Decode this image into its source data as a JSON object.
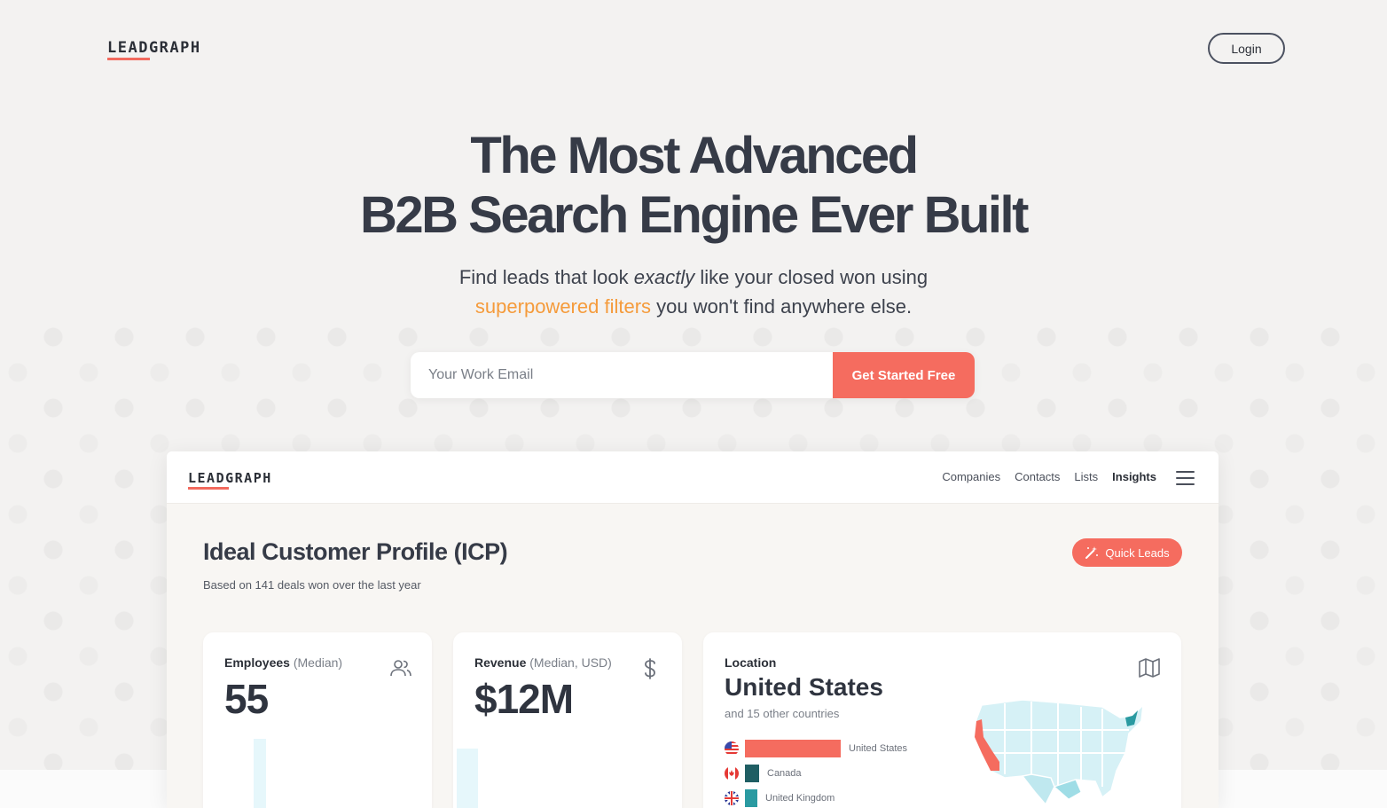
{
  "brand": {
    "name": "LEADGRAPH"
  },
  "header": {
    "login_label": "Login"
  },
  "hero": {
    "title_line1": "The Most Advanced",
    "title_line2": "B2B Search Engine Ever Built",
    "subtitle_part1": "Find leads that look ",
    "subtitle_emphasis": "exactly",
    "subtitle_part2": " like your closed won using",
    "subtitle_accent": "superpowered filters",
    "subtitle_part3": " you won't find anywhere else."
  },
  "signup": {
    "email_placeholder": "Your Work Email",
    "cta_label": "Get Started Free"
  },
  "app": {
    "logo": "LEADGRAPH",
    "nav": {
      "companies": "Companies",
      "contacts": "Contacts",
      "lists": "Lists",
      "insights": "Insights",
      "active": "insights"
    },
    "icp": {
      "title": "Ideal Customer Profile (ICP)",
      "subtitle": "Based on 141 deals won over the last year",
      "quick_leads_label": "Quick Leads"
    },
    "cards": {
      "employees": {
        "label": "Employees",
        "qualifier": " (Median)",
        "value": "55",
        "icon": "users-icon"
      },
      "revenue": {
        "label": "Revenue",
        "qualifier": " (Median, USD)",
        "value": "$12M",
        "icon": "dollar-icon"
      },
      "location": {
        "label": "Location",
        "value": "United States",
        "detail": "and 15 other countries",
        "icon": "map-icon",
        "countries": [
          {
            "name": "United States",
            "share": 1.0,
            "color": "#f56c5f"
          },
          {
            "name": "Canada",
            "share": 0.15,
            "color": "#1f5e63"
          },
          {
            "name": "United Kingdom",
            "share": 0.13,
            "color": "#2a9aa1"
          }
        ]
      }
    }
  },
  "colors": {
    "accent": "#f56c5f",
    "highlight": "#f59b3b",
    "text_dark": "#363b47",
    "map_fill": "#d6f1f6",
    "map_dark": "#6cc8d2"
  }
}
